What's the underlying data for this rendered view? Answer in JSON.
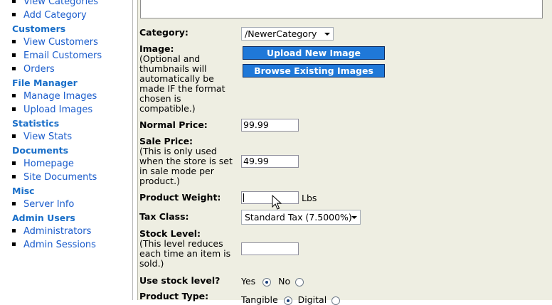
{
  "sidebar": {
    "sections": [
      {
        "id": "catalog",
        "title": "",
        "items": [
          "View Categories",
          "Add Category"
        ]
      },
      {
        "id": "customers",
        "title": "Customers",
        "items": [
          "View Customers",
          "Email Customers",
          "Orders"
        ]
      },
      {
        "id": "file-manager",
        "title": "File Manager",
        "items": [
          "Manage Images",
          "Upload Images"
        ]
      },
      {
        "id": "statistics",
        "title": "Statistics",
        "items": [
          "View Stats"
        ]
      },
      {
        "id": "documents",
        "title": "Documents",
        "items": [
          "Homepage",
          "Site Documents"
        ]
      },
      {
        "id": "misc",
        "title": "Misc",
        "items": [
          "Server Info"
        ]
      },
      {
        "id": "admin-users",
        "title": "Admin Users",
        "items": [
          "Administrators",
          "Admin Sessions"
        ]
      }
    ]
  },
  "form": {
    "category": {
      "label": "Category:",
      "value": "/NewerCategory"
    },
    "image": {
      "label": "Image:",
      "note": "(Optional and thumbnails will automatically be made IF the format chosen is compatible.)",
      "upload_button": "Upload New Image",
      "browse_button": "Browse Existing Images"
    },
    "normal_price": {
      "label": "Normal Price:",
      "value": "99.99"
    },
    "sale_price": {
      "label": "Sale Price:",
      "note": "(This is only used when the store is set in sale mode per product.)",
      "value": "49.99"
    },
    "product_weight": {
      "label": "Product Weight:",
      "value": "",
      "unit": "Lbs"
    },
    "tax_class": {
      "label": "Tax Class:",
      "value": "Standard Tax (7.5000%)"
    },
    "stock_level": {
      "label": "Stock Level:",
      "note": "(This level reduces each time an item is sold.)",
      "value": ""
    },
    "use_stock_level": {
      "label": "Use stock level?",
      "yes": "Yes",
      "no": "No",
      "selected": "Yes"
    },
    "product_type": {
      "label": "Product Type:",
      "tangible": "Tangible",
      "digital": "Digital",
      "selected": "Tangible"
    }
  },
  "colors": {
    "panel_bg": "#eeeee2",
    "link": "#1a5ccc",
    "section_head": "#1a6fc9",
    "button_blue": "#1f78d8"
  },
  "icons": {
    "cursor": "arrow-cursor-icon"
  }
}
